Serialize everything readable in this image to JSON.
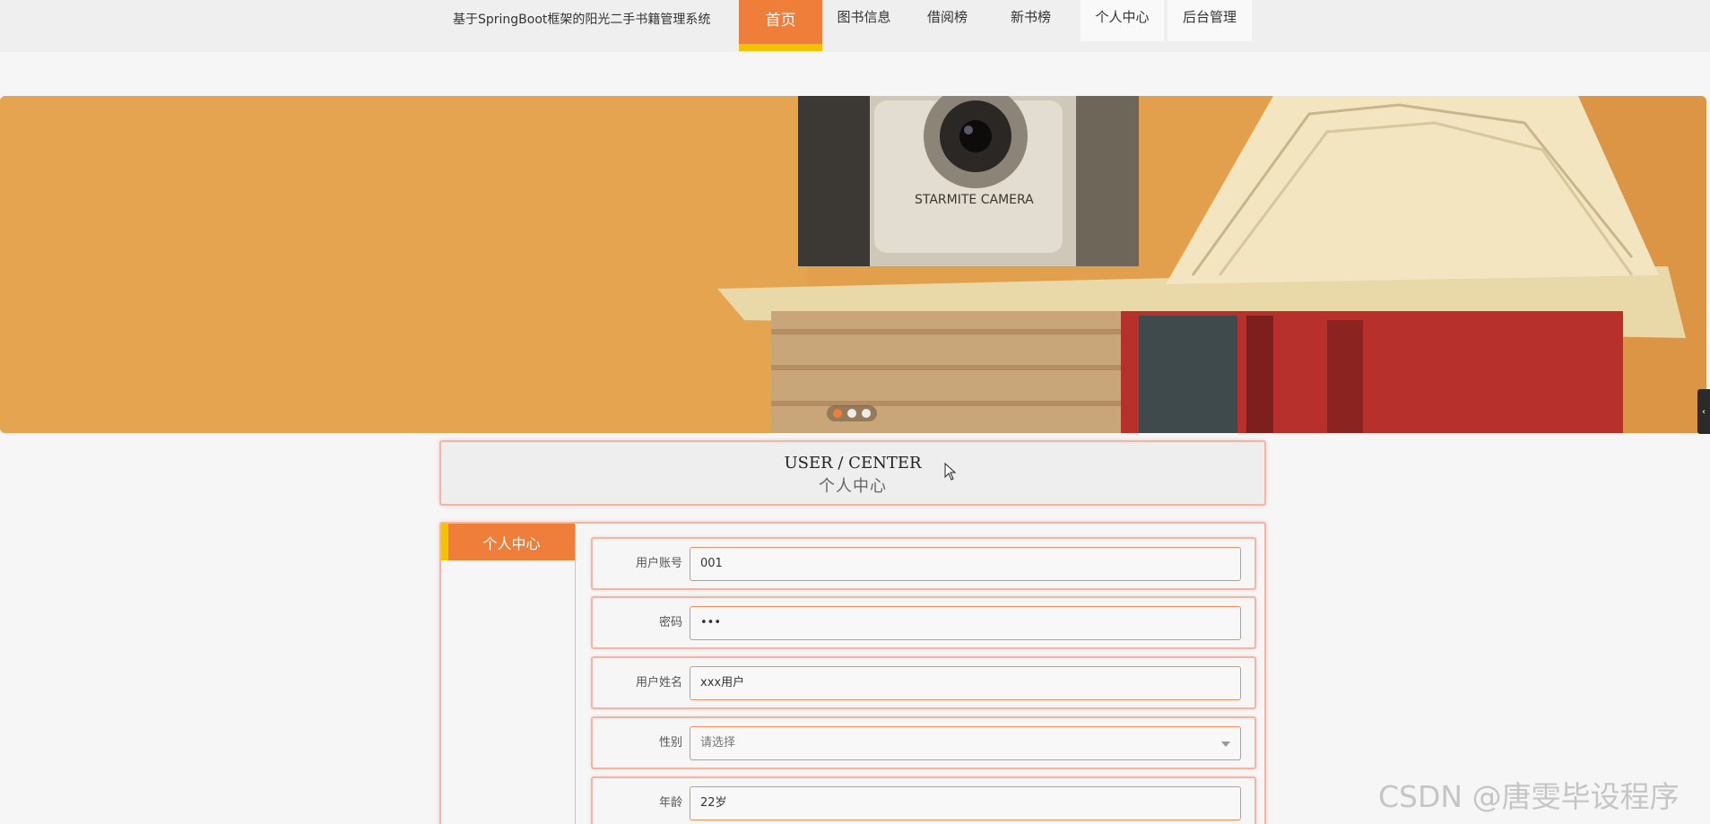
{
  "header": {
    "site_title": "基于SpringBoot框架的阳光二手书籍管理系统",
    "nav": [
      {
        "label": "首页",
        "active": true
      },
      {
        "label": "图书信息",
        "active": false
      },
      {
        "label": "借阅榜",
        "active": false
      },
      {
        "label": "新书榜",
        "active": false
      },
      {
        "label": "个人中心",
        "active": false
      },
      {
        "label": "后台管理",
        "active": false
      }
    ]
  },
  "banner": {
    "slide_count": 3,
    "active_slide": 1,
    "camera_brand": "STARMITE CAMERA"
  },
  "section": {
    "title_en": "USER / CENTER",
    "title_cn": "个人中心"
  },
  "side_menu": {
    "items": [
      {
        "label": "个人中心"
      }
    ]
  },
  "form": {
    "fields": [
      {
        "label": "用户账号",
        "value": "001"
      },
      {
        "label": "密码",
        "value": "•••"
      },
      {
        "label": "用户姓名",
        "value": "xxx用户"
      },
      {
        "label": "性别",
        "value": "",
        "placeholder": "请选择"
      },
      {
        "label": "年龄",
        "value": "22岁"
      }
    ]
  },
  "colors": {
    "accent": "#ef7e3a",
    "highlight": "#f2c300",
    "border": "#f2b5a6"
  },
  "watermark": "CSDN @唐雯毕设程序"
}
